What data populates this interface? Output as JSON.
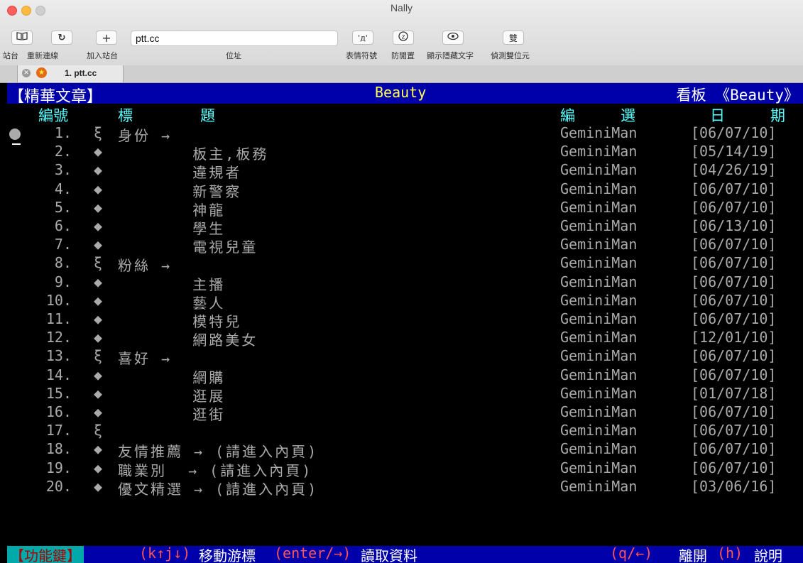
{
  "window": {
    "title": "Nally"
  },
  "toolbar": {
    "address": "ptt.cc",
    "address_label": "位址",
    "sites_label": "站台",
    "reconnect_label": "重新連線",
    "add_site_label": "加入站台",
    "emoticon_label": "表情符號",
    "anti_idle_label": "防閒置",
    "show_hidden_label": "顯示隱藏文字",
    "detect_dbcs_label": "偵測雙位元",
    "dbcs_char": "雙"
  },
  "tab": {
    "label": "1. ptt.cc"
  },
  "header": {
    "left": "【精華文章】",
    "board": "Beauty",
    "right": "看板 《Beauty》"
  },
  "columns": {
    "num": "編號",
    "title1": "標",
    "title2": "題",
    "author1": "編",
    "author2": "選",
    "date1": "日",
    "date2": "期"
  },
  "rows": [
    {
      "num": "1.",
      "mark": "ξ",
      "title": "身份 →",
      "author": "GeminiMan",
      "date": "[06/07/10]"
    },
    {
      "num": "2.",
      "mark": "◆",
      "title": "       板主,板務",
      "author": "GeminiMan",
      "date": "[05/14/19]"
    },
    {
      "num": "3.",
      "mark": "◆",
      "title": "       違規者",
      "author": "GeminiMan",
      "date": "[04/26/19]"
    },
    {
      "num": "4.",
      "mark": "◆",
      "title": "       新警察",
      "author": "GeminiMan",
      "date": "[06/07/10]"
    },
    {
      "num": "5.",
      "mark": "◆",
      "title": "       神龍",
      "author": "GeminiMan",
      "date": "[06/07/10]"
    },
    {
      "num": "6.",
      "mark": "◆",
      "title": "       學生",
      "author": "GeminiMan",
      "date": "[06/13/10]"
    },
    {
      "num": "7.",
      "mark": "◆",
      "title": "       電視兒童",
      "author": "GeminiMan",
      "date": "[06/07/10]"
    },
    {
      "num": "8.",
      "mark": "ξ",
      "title": "粉絲 →",
      "author": "GeminiMan",
      "date": "[06/07/10]"
    },
    {
      "num": "9.",
      "mark": "◆",
      "title": "       主播",
      "author": "GeminiMan",
      "date": "[06/07/10]"
    },
    {
      "num": "10.",
      "mark": "◆",
      "title": "       藝人",
      "author": "GeminiMan",
      "date": "[06/07/10]"
    },
    {
      "num": "11.",
      "mark": "◆",
      "title": "       模特兒",
      "author": "GeminiMan",
      "date": "[06/07/10]"
    },
    {
      "num": "12.",
      "mark": "◆",
      "title": "       網路美女",
      "author": "GeminiMan",
      "date": "[12/01/10]"
    },
    {
      "num": "13.",
      "mark": "ξ",
      "title": "喜好 →",
      "author": "GeminiMan",
      "date": "[06/07/10]"
    },
    {
      "num": "14.",
      "mark": "◆",
      "title": "       網購",
      "author": "GeminiMan",
      "date": "[06/07/10]"
    },
    {
      "num": "15.",
      "mark": "◆",
      "title": "       逛展",
      "author": "GeminiMan",
      "date": "[01/07/18]"
    },
    {
      "num": "16.",
      "mark": "◆",
      "title": "       逛街",
      "author": "GeminiMan",
      "date": "[06/07/10]"
    },
    {
      "num": "17.",
      "mark": "ξ",
      "title": "",
      "author": "GeminiMan",
      "date": "[06/07/10]"
    },
    {
      "num": "18.",
      "mark": "◆",
      "title": "友情推薦 → (請進入內頁)",
      "author": "GeminiMan",
      "date": "[06/07/10]"
    },
    {
      "num": "19.",
      "mark": "◆",
      "title": "職業別  → (請進入內頁)",
      "author": "GeminiMan",
      "date": "[06/07/10]"
    },
    {
      "num": "20.",
      "mark": "◆",
      "title": "優文精選 → (請進入內頁)",
      "author": "GeminiMan",
      "date": "[03/06/16]"
    }
  ],
  "footer": {
    "label": "【功能鍵】",
    "k1": "(k↑j↓)",
    "t1": "移動游標",
    "k2": "(enter/→)",
    "t2": "讀取資料",
    "k3": "(q/←)",
    "t3": "離開",
    "k4": "(h)",
    "t4": "說明"
  }
}
